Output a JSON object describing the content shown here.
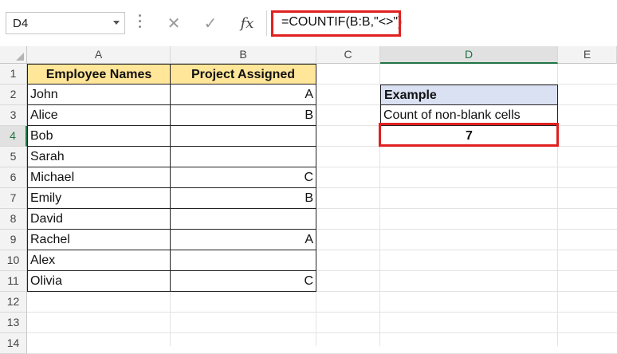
{
  "name_box": {
    "value": "D4"
  },
  "formula_bar": {
    "cancel_icon": "x-icon",
    "enter_icon": "check-icon",
    "fx_label": "fx",
    "formula": "=COUNTIF(B:B,\"<>\")"
  },
  "columns": [
    "A",
    "B",
    "C",
    "D",
    "E"
  ],
  "active_column": "D",
  "rows": [
    "1",
    "2",
    "3",
    "4",
    "5",
    "6",
    "7",
    "8",
    "9",
    "10",
    "11",
    "12",
    "13",
    "14"
  ],
  "active_row": "4",
  "table": {
    "headers": [
      "Employee Names",
      "Project Assigned"
    ],
    "rows": [
      {
        "name": "John",
        "project": "A"
      },
      {
        "name": "Alice",
        "project": "B"
      },
      {
        "name": "Bob",
        "project": ""
      },
      {
        "name": "Sarah",
        "project": ""
      },
      {
        "name": "Michael",
        "project": "C"
      },
      {
        "name": "Emily",
        "project": "B"
      },
      {
        "name": "David",
        "project": ""
      },
      {
        "name": "Rachel",
        "project": "A"
      },
      {
        "name": "Alex",
        "project": ""
      },
      {
        "name": "Olivia",
        "project": "C"
      }
    ]
  },
  "example": {
    "header": "Example",
    "label": "Count of non-blank cells",
    "result": "7"
  },
  "colors": {
    "header_fill": "#ffe699",
    "example_fill": "#d9e1f2",
    "highlight": "#e02020",
    "active_accent": "#217346"
  }
}
